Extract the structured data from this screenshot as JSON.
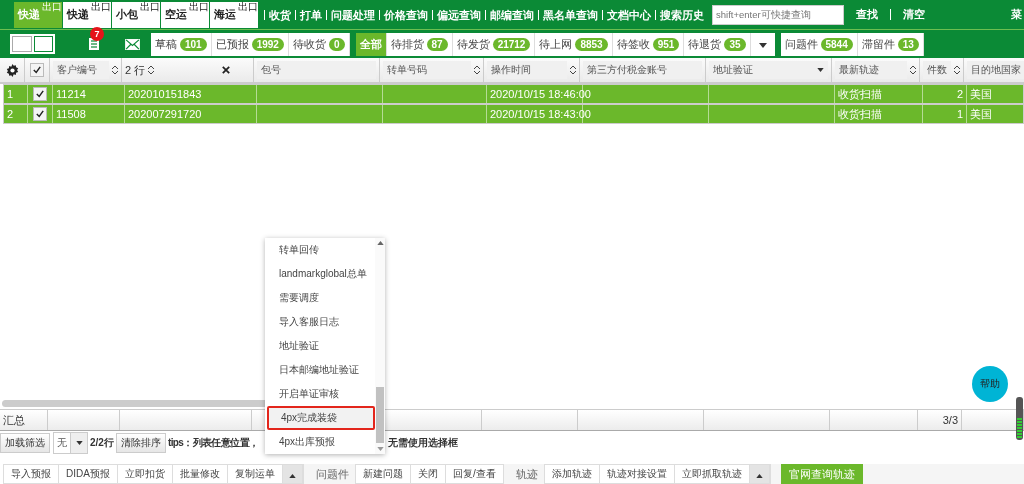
{
  "nav_tabs": [
    {
      "label": "快递",
      "tag": "出口",
      "selected": true
    },
    {
      "label": "快递",
      "tag": "出口",
      "selected": false
    },
    {
      "label": "小包",
      "tag": "出口",
      "selected": false
    },
    {
      "label": "空运",
      "tag": "出口",
      "selected": false
    },
    {
      "label": "海运",
      "tag": "出口",
      "selected": false
    }
  ],
  "nav_links": [
    "收货",
    "打单",
    "问题处理",
    "价格查询",
    "偏远查询",
    "邮编查询",
    "黑名单查询",
    "文档中心",
    "搜索历史"
  ],
  "search": {
    "placeholder": "shift+enter可快捷查询"
  },
  "search_actions": [
    "查找",
    "清空"
  ],
  "menu": "菜",
  "notification_count": "7",
  "status_groups": [
    [
      {
        "label": "草稿",
        "count": "101",
        "selected": false
      },
      {
        "label": "已预报",
        "count": "1992",
        "selected": false
      },
      {
        "label": "待收货",
        "count": "0",
        "selected": false
      }
    ],
    [
      {
        "label": "全部",
        "selected": true
      },
      {
        "label": "待排货",
        "count": "87",
        "selected": false
      },
      {
        "label": "待发货",
        "count": "21712",
        "selected": false
      },
      {
        "label": "待上网",
        "count": "8853",
        "selected": false
      },
      {
        "label": "待签收",
        "count": "951",
        "selected": false
      },
      {
        "label": "待退货",
        "count": "35",
        "selected": false
      }
    ],
    [
      {
        "label": "问题件",
        "count": "5844",
        "selected": false
      },
      {
        "label": "滞留件",
        "count": "13",
        "selected": false
      }
    ]
  ],
  "table": {
    "all_checked": true,
    "columns": [
      {
        "label": "客户编号",
        "kind": "sort"
      },
      {
        "label": "2 行",
        "kind": "sort-clear"
      },
      {
        "label": "包号",
        "kind": "plain"
      },
      {
        "label": "转单号码",
        "kind": "sort"
      },
      {
        "label": "操作时间",
        "kind": "sort"
      },
      {
        "label": "第三方付税金账号",
        "kind": "plain"
      },
      {
        "label": "地址验证",
        "kind": "dropdown"
      },
      {
        "label": "最新轨迹",
        "kind": "sort"
      },
      {
        "label": "件数",
        "kind": "sort"
      },
      {
        "label": "目的地国家",
        "kind": "plain"
      }
    ],
    "rows": [
      {
        "index": "1",
        "checked": true,
        "selected": true,
        "cells": [
          "11214",
          "202010151843",
          null,
          null,
          "2020/10/15 18:46:00",
          null,
          null,
          "收货扫描",
          "2",
          "美国"
        ]
      },
      {
        "index": "2",
        "checked": true,
        "selected": true,
        "cells": [
          "11508",
          "202007291720",
          null,
          null,
          "2020/10/15 18:43:00",
          null,
          null,
          "收货扫描",
          "1",
          "美国"
        ]
      }
    ],
    "summary": {
      "label": "汇总",
      "pieces_total": "3/3"
    }
  },
  "toolbar": {
    "load_filter": "加载筛选",
    "filter_value": "无",
    "row_info": "2/2行",
    "clear_sort": "清除排序",
    "tips_visible_start": "tips：列表任意位置，",
    "tips_visible_end": "无需使用选择框"
  },
  "dropdown": [
    {
      "label": "转单回传",
      "selected": false
    },
    {
      "label": "landmarkglobal总单",
      "selected": false
    },
    {
      "label": "需要调度",
      "selected": false
    },
    {
      "label": "导入客服日志",
      "selected": false
    },
    {
      "label": "地址验证",
      "selected": false
    },
    {
      "label": "日本邮编地址验证",
      "selected": false
    },
    {
      "label": "开启单证审核",
      "selected": false
    },
    {
      "label": "4px完成装袋",
      "selected": true
    },
    {
      "label": "4px出库预报",
      "selected": false
    }
  ],
  "help": "帮助",
  "bottom_groups": [
    {
      "buttons": [
        "导入预报",
        "DIDA预报",
        "立即扣货",
        "批量修改",
        "复制运单"
      ],
      "more": true
    },
    {
      "label": "问题件",
      "buttons": [
        "新建问题",
        "关闭",
        "回复/查看"
      ],
      "more": false
    },
    {
      "label": "轨迹",
      "buttons": [
        "添加轨迹",
        "轨迹对接设置",
        "立即抓取轨迹"
      ],
      "more": true
    }
  ],
  "primary_button": "官网查询轨迹"
}
